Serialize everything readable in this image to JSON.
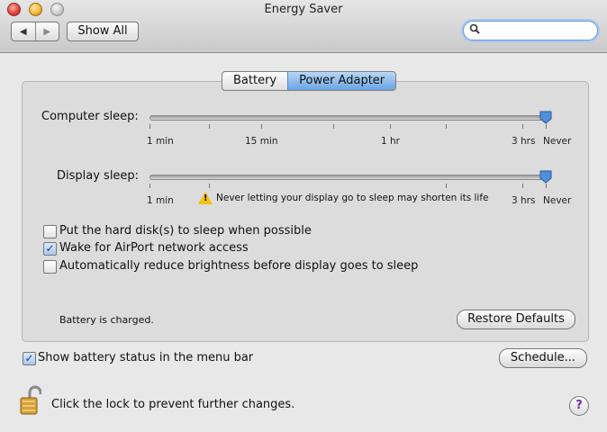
{
  "window": {
    "title": "Energy Saver"
  },
  "toolbar": {
    "back_glyph": "◀",
    "forward_glyph": "▶",
    "show_all_label": "Show All",
    "search_placeholder": ""
  },
  "tabs": [
    {
      "label": "Battery",
      "active": false
    },
    {
      "label": "Power Adapter",
      "active": true
    }
  ],
  "computer_sleep": {
    "label": "Computer sleep:",
    "ticks": [
      "1 min",
      "15 min",
      "1 hr",
      "3 hrs",
      "Never"
    ],
    "value": "Never"
  },
  "display_sleep": {
    "label": "Display sleep:",
    "ticks": [
      "1 min",
      "3 hrs",
      "Never"
    ],
    "value": "Never",
    "warning": "Never letting your display go to sleep may shorten its life"
  },
  "options": [
    {
      "label": "Put the hard disk(s) to sleep when possible",
      "checked": false
    },
    {
      "label": "Wake for AirPort network access",
      "checked": true
    },
    {
      "label": "Automatically reduce brightness before display goes to sleep",
      "checked": false
    }
  ],
  "status_text": "Battery is charged.",
  "restore_defaults_label": "Restore Defaults",
  "show_battery_label": "Show battery status in the menu bar",
  "show_battery_checked": true,
  "schedule_label": "Schedule...",
  "lock_text": "Click the lock to prevent further changes.",
  "help_label": "?",
  "colors": {
    "selected_tab": "#6aa3e3",
    "help_accent": "#7a2ab0",
    "warning": "#f2c20f"
  }
}
